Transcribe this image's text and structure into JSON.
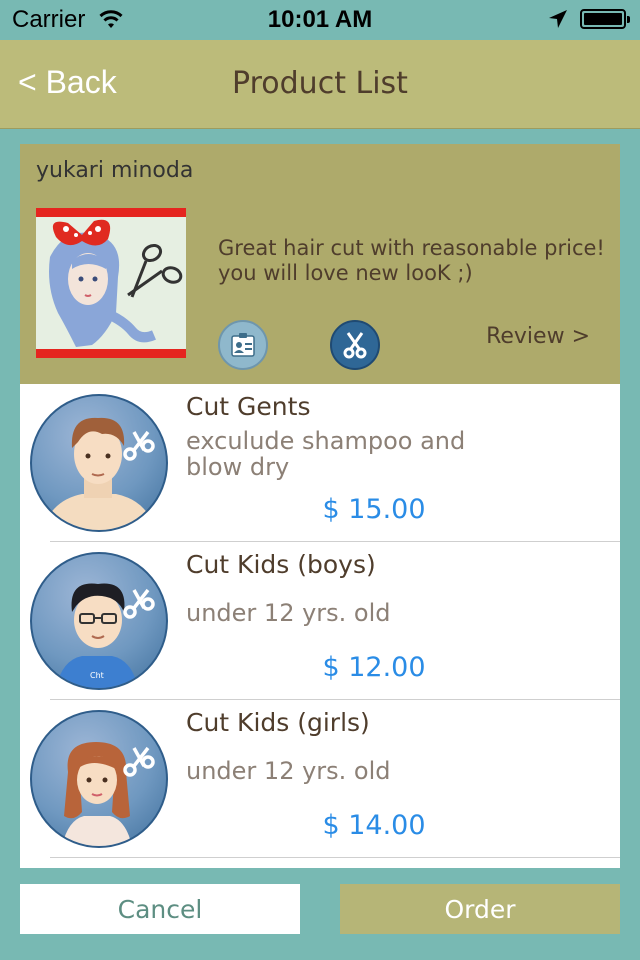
{
  "status_bar": {
    "carrier": "Carrier",
    "time": "10:01 AM",
    "icons": [
      "wifi-icon",
      "location-arrow-icon",
      "battery-icon"
    ]
  },
  "nav": {
    "back_label": "< Back",
    "title": "Product List"
  },
  "profile": {
    "name": "yukari minoda",
    "description": "Great hair cut with reasonable price! you will love new looK ;)",
    "review_label": "Review >",
    "icons": [
      "id-card-icon",
      "scissors-icon"
    ]
  },
  "products": [
    {
      "name": "Cut Gents",
      "description": "exculude shampoo and blow dry",
      "price": "$ 15.00",
      "icon": "man-with-scissors-icon"
    },
    {
      "name": "Cut Kids (boys)",
      "description": "under 12 yrs. old",
      "price": "$ 12.00",
      "icon": "boy-with-scissors-icon"
    },
    {
      "name": "Cut Kids (girls)",
      "description": "under 12 yrs. old",
      "price": "$ 14.00",
      "icon": "girl-with-scissors-icon"
    }
  ],
  "actions": {
    "cancel_label": "Cancel",
    "order_label": "Order"
  },
  "colors": {
    "background": "#78b9b3",
    "nav_bar": "#bcbb7a",
    "profile_panel": "#aeaa6b",
    "price": "#2a8ce6",
    "order_button": "#b6b577"
  }
}
